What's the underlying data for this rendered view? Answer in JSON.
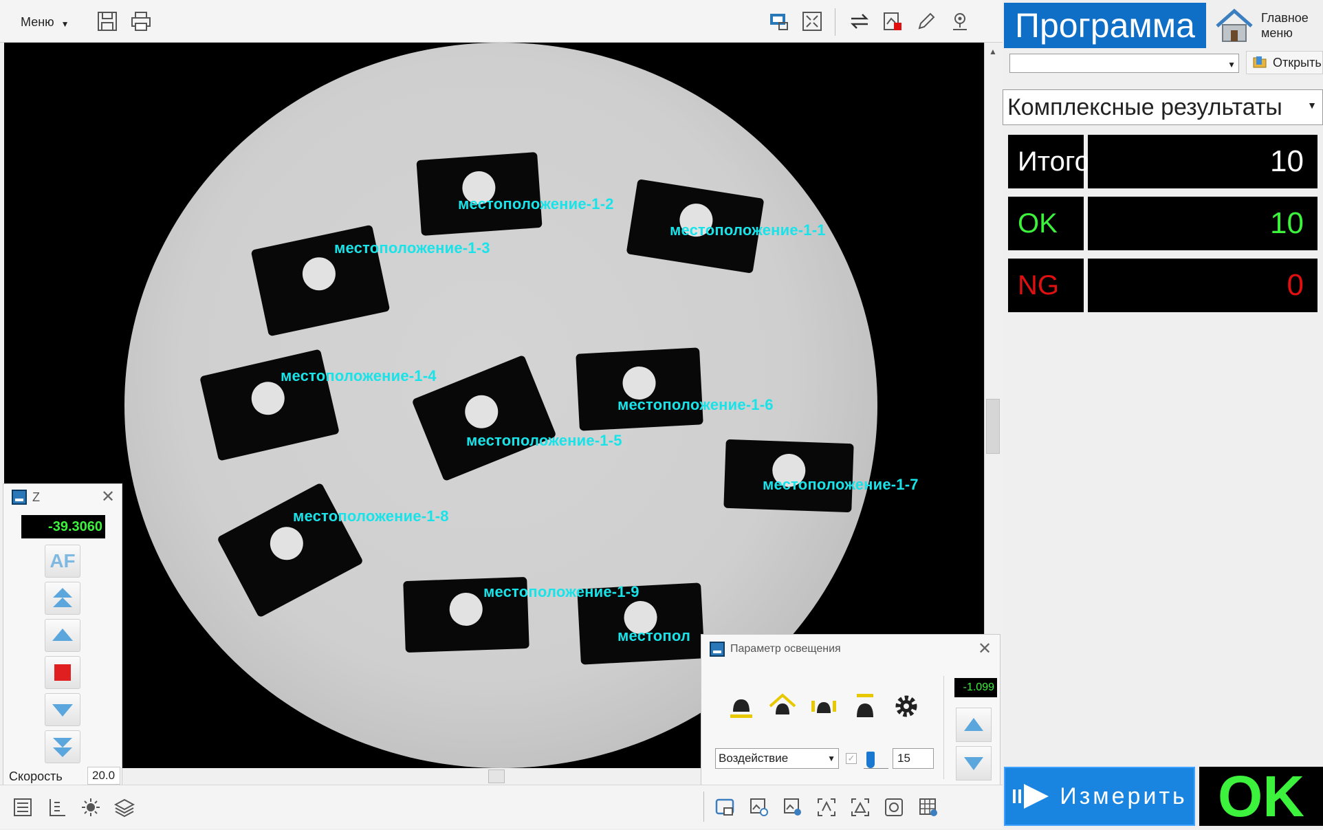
{
  "toolbar": {
    "menu_label": "Меню"
  },
  "viewport": {
    "labels": [
      "местоположение-1-1",
      "местоположение-1-2",
      "местоположение-1-3",
      "местоположение-1-4",
      "местоположение-1-5",
      "местоположение-1-6",
      "местоположение-1-7",
      "местоположение-1-8",
      "местоположение-1-9",
      "местопол"
    ],
    "label_color": "#19e3e8"
  },
  "right_panel": {
    "program_title": "Программа",
    "home_label_line1": "Главное",
    "home_label_line2": "меню",
    "open_label": "Открыть",
    "results_mode": "Комплексные результаты",
    "results": [
      {
        "name": "Итого",
        "value": "10",
        "color": "#ffffff"
      },
      {
        "name": "OK",
        "value": "10",
        "color": "#3cf23c"
      },
      {
        "name": "NG",
        "value": "0",
        "color": "#e01010"
      }
    ],
    "measure_label": "Измерить",
    "overall_status": "OK"
  },
  "z_panel": {
    "title": "Z",
    "z_value": "-39.3060",
    "af_label": "AF",
    "speed_label": "Скорость",
    "speed_value": "20.0"
  },
  "lighting_panel": {
    "title": "Параметр освещения",
    "mode": "Воздействие",
    "intensity": "15",
    "value": "-1.099"
  },
  "colors": {
    "accent": "#0f6fc6",
    "ok_green": "#3cf23c",
    "ng_red": "#e01010"
  }
}
